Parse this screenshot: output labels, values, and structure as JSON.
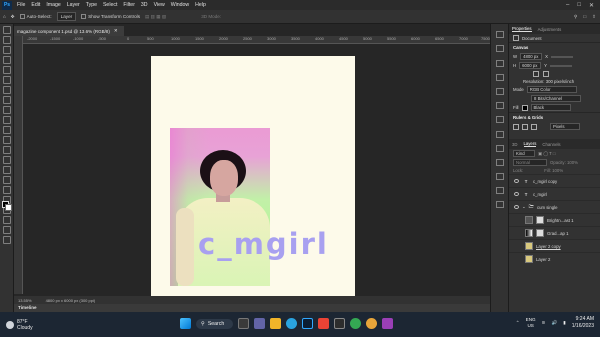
{
  "menu": {
    "items": [
      "File",
      "Edit",
      "Image",
      "Layer",
      "Type",
      "Select",
      "Filter",
      "3D",
      "View",
      "Window",
      "Help"
    ],
    "app_badge": "Ps"
  },
  "options": {
    "auto_select": "Auto-Select:",
    "auto_select_value": "Layer",
    "show_transform": "Show Transform Controls",
    "mode_3d": "3D Mode:"
  },
  "document": {
    "tab_title": "magazine component 1.psd @ 13.6% (RGB/8)",
    "zoom": "13.55%",
    "dimensions": "4800 px x 6000 px (300 ppi)",
    "wordmark": "c_mgirl"
  },
  "ruler": {
    "ticks": [
      "-2000",
      "-1500",
      "-1000",
      "-500",
      "0",
      "500",
      "1000",
      "1500",
      "2000",
      "2500",
      "3000",
      "3500",
      "4000",
      "4500",
      "5000",
      "5500",
      "6000",
      "6500",
      "7000",
      "7500"
    ]
  },
  "timeline": "Timeline",
  "properties": {
    "tab_active": "Properties",
    "tab_inactive": "Adjustments",
    "doc_label": "Document",
    "canvas_section": "Canvas",
    "w_label": "W",
    "w_value": "4800 px",
    "x_label": "X",
    "h_label": "H",
    "h_value": "6000 px",
    "y_label": "Y",
    "resolution": "Resolution: 300 pixels/inch",
    "mode_label": "Mode",
    "mode_value": "RGB Color",
    "bits_value": "8 Bits/Channel",
    "fill_label": "Fill",
    "fill_value": "Black",
    "rulers_section": "Rulers & Grids",
    "units_value": "Pixels"
  },
  "layers": {
    "tab_3d": "3D",
    "tab_layers": "Layers",
    "tab_channels": "Channels",
    "kind": "Kind",
    "blend": "Normal",
    "opacity": "Opacity: 100%",
    "lock": "Lock:",
    "fill": "Fill: 100%",
    "items": [
      "c_mgirl copy",
      "c_mgirl",
      "cum single",
      "Brightn...ast 1",
      "Grad...ap 1",
      "Layer 2 copy",
      "Layer 2"
    ]
  },
  "taskbar": {
    "temp": "87°F",
    "condition": "Cloudy",
    "search": "Search",
    "lang": "ENG",
    "region": "US",
    "time": "9:24 AM",
    "date": "1/16/2023"
  }
}
